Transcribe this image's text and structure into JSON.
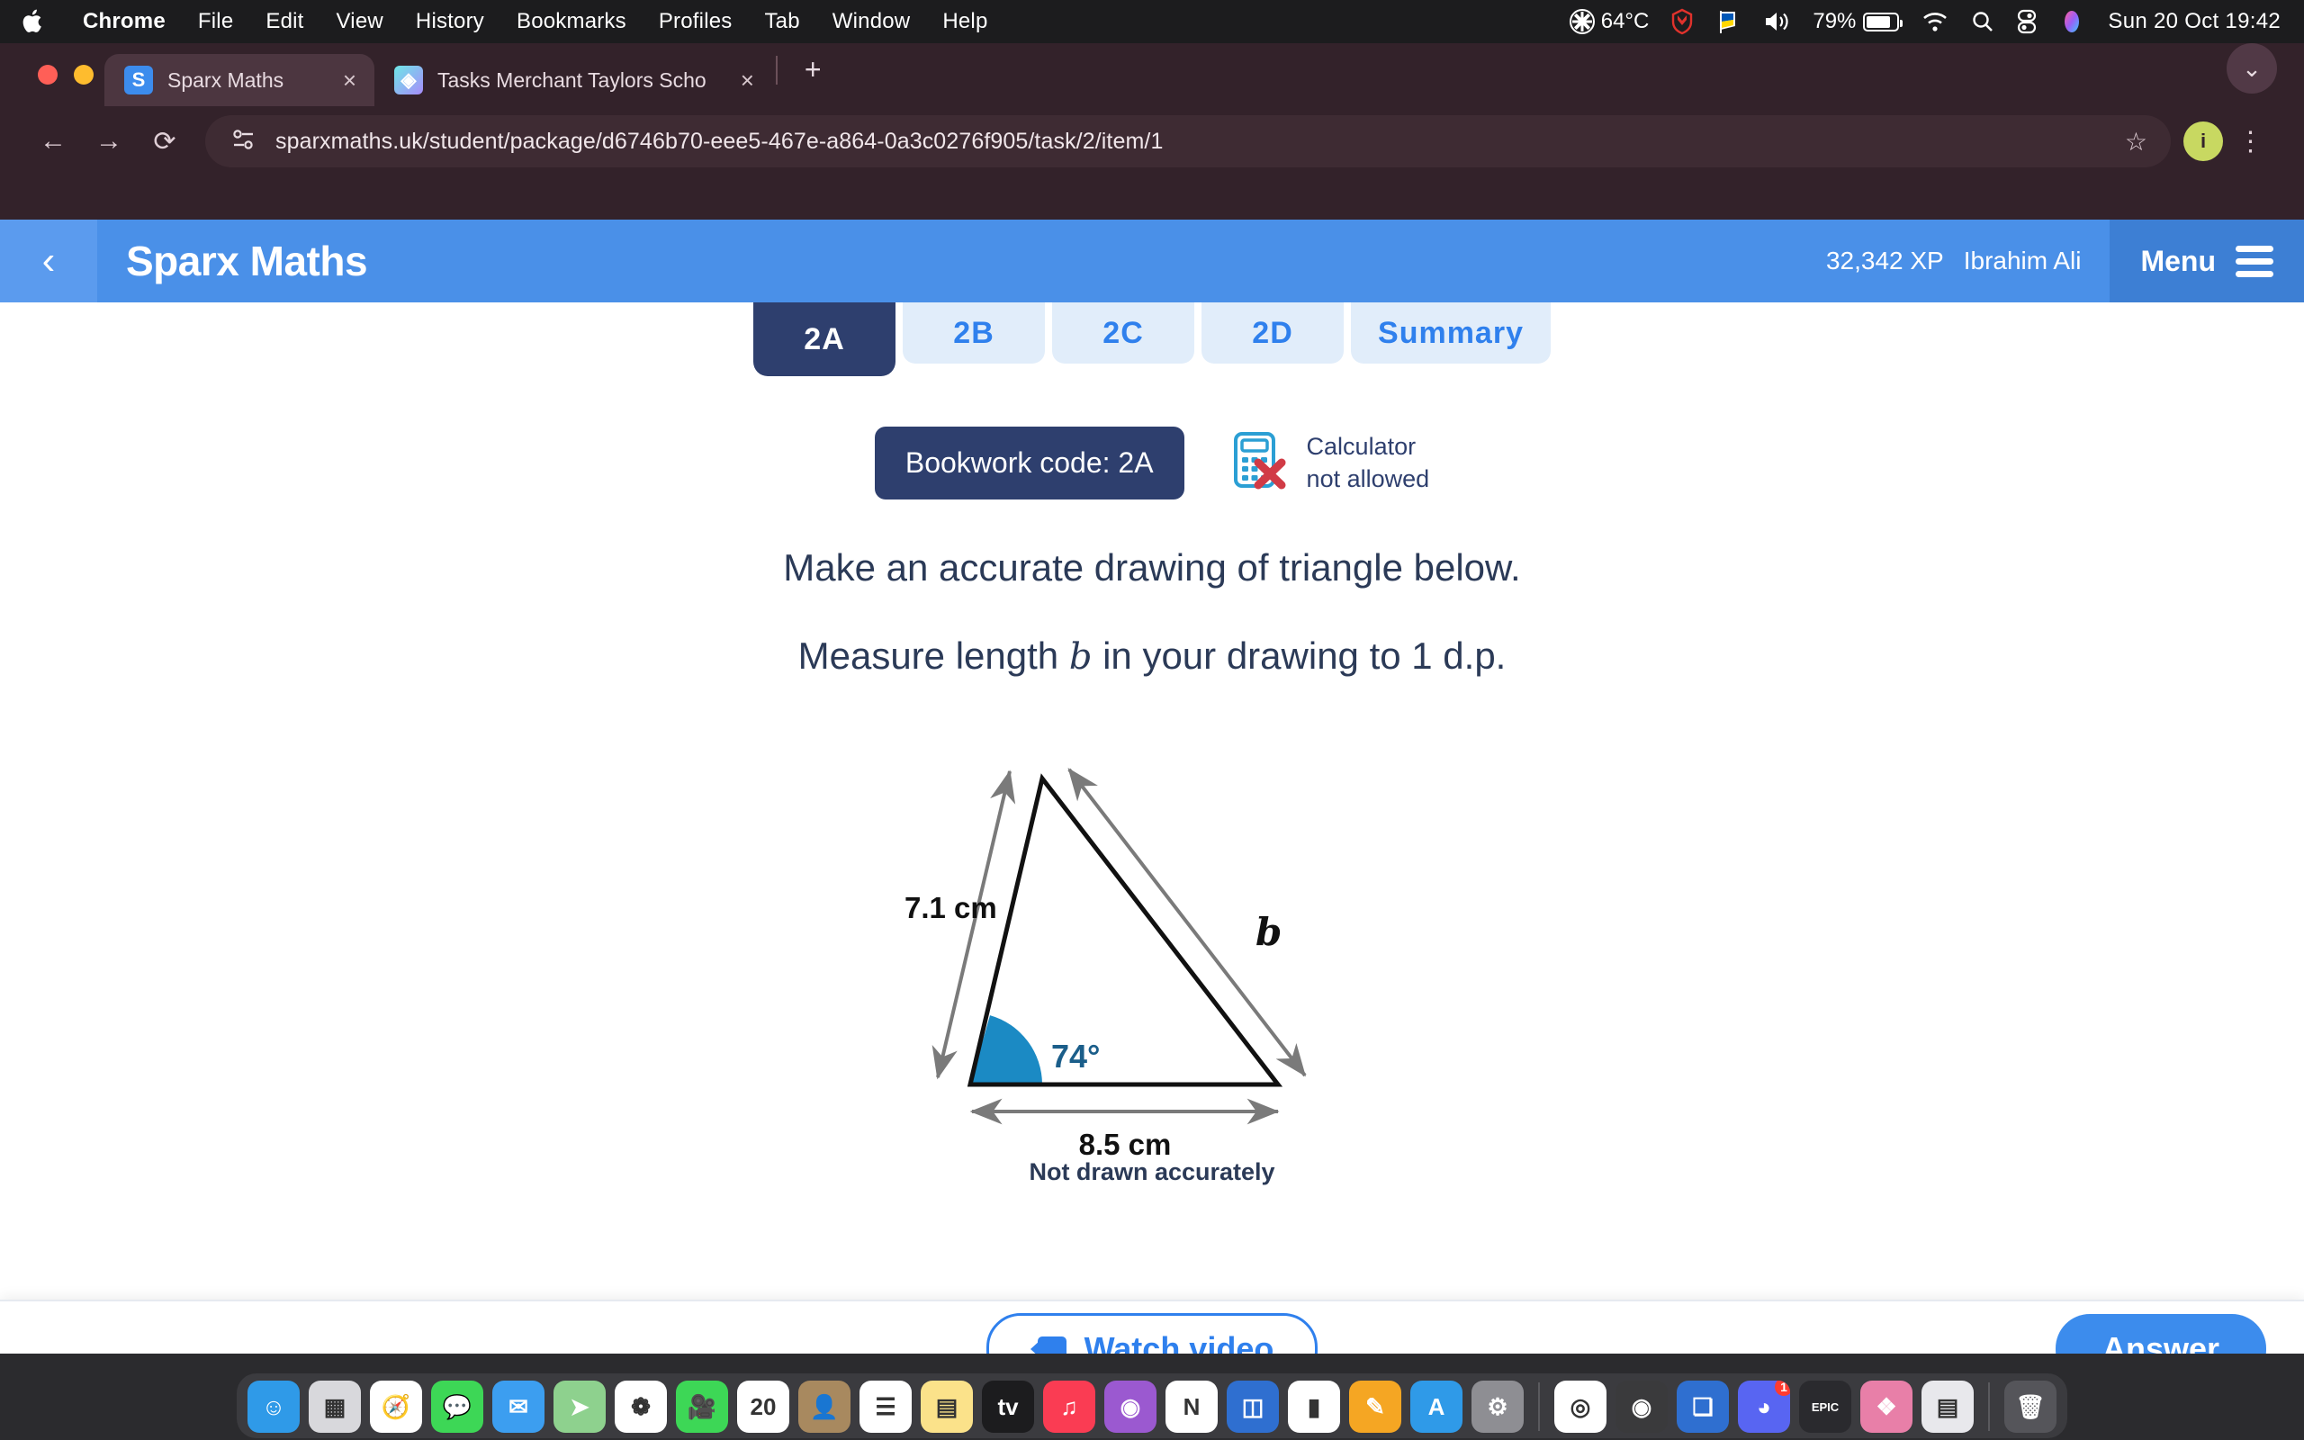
{
  "menubar": {
    "apple_icon": "apple-logo",
    "items": [
      "Chrome",
      "File",
      "Edit",
      "View",
      "History",
      "Bookmarks",
      "Profiles",
      "Tab",
      "Window",
      "Help"
    ],
    "status": {
      "temperature": "64°C",
      "battery_percent": "79%",
      "clock": "Sun 20 Oct  19:42",
      "icons": [
        "fan-icon",
        "shield-icon",
        "flag-icon",
        "volume-icon",
        "battery-icon",
        "wifi-icon",
        "search-icon",
        "control-center-icon",
        "siri-icon"
      ]
    }
  },
  "browser": {
    "tabs": [
      {
        "title": "Sparx Maths",
        "favicon": "sparx-favicon",
        "active": true,
        "close": "×"
      },
      {
        "title": "Tasks Merchant Taylors Scho",
        "favicon": "tasks-favicon",
        "active": false,
        "close": "×"
      }
    ],
    "new_tab_label": "+",
    "tabstrip_chevron": "⌄",
    "back_icon": "←",
    "forward_icon": "→",
    "reload_icon": "⟳",
    "site_info_icon": "page-settings-icon",
    "url": "sparxmaths.uk/student/package/d6746b70-eee5-467e-a864-0a3c0276f905/task/2/item/1",
    "bookmark_icon": "☆",
    "profile_initial": "i",
    "menu_icon": "⋮"
  },
  "app_header": {
    "back_icon": "‹",
    "title": "Sparx Maths",
    "xp": "32,342 XP",
    "user": "Ibrahim Ali",
    "menu_label": "Menu",
    "menu_icon": "hamburger-icon",
    "colors": {
      "header_bg": "#4a90e8",
      "menu_bg": "#3d7fd4"
    }
  },
  "question_tabs": [
    {
      "label": "2A",
      "active": true
    },
    {
      "label": "2B",
      "active": false
    },
    {
      "label": "2C",
      "active": false
    },
    {
      "label": "2D",
      "active": false
    },
    {
      "label": "Summary",
      "active": false
    }
  ],
  "meta": {
    "bookwork_code": "Bookwork code: 2A",
    "calculator_line1": "Calculator",
    "calculator_line2": "not allowed",
    "calculator_icon": "calculator-not-allowed-icon"
  },
  "question": {
    "line1": "Make an accurate drawing of triangle below.",
    "line2_before": "Measure length",
    "line2_var": "b",
    "line2_after": "in your drawing to 1 d.p.",
    "caption": "Not drawn accurately"
  },
  "figure": {
    "type": "triangle-diagram",
    "left_side_label": "7.1 cm",
    "base_label": "8.5 cm",
    "right_side_label": "b",
    "angle_label": "74°",
    "colors": {
      "angle_fill": "#1b8ac4",
      "angle_text": "#1b5e8a",
      "edge": "#111111",
      "dimension": "#7a7a7a"
    }
  },
  "bottom_bar": {
    "watch_video_label": "Watch video",
    "watch_video_icon": "video-camera-icon",
    "answer_label": "Answer",
    "colors": {
      "accent": "#3c8ced"
    }
  },
  "dock": {
    "items": [
      {
        "name": "finder",
        "glyph": "☺",
        "bg": "#2f9ae8",
        "running": true
      },
      {
        "name": "launchpad",
        "glyph": "▦",
        "bg": "#d8d8dc",
        "running": false
      },
      {
        "name": "safari",
        "glyph": "🧭",
        "bg": "#ffffff",
        "running": false
      },
      {
        "name": "messages",
        "glyph": "💬",
        "bg": "#3dd756",
        "running": false
      },
      {
        "name": "mail",
        "glyph": "✉",
        "bg": "#3c9ef0",
        "running": false
      },
      {
        "name": "maps",
        "glyph": "➤",
        "bg": "#8ed18e",
        "running": false
      },
      {
        "name": "photos",
        "glyph": "❁",
        "bg": "#ffffff",
        "running": false
      },
      {
        "name": "facetime",
        "glyph": "🎥",
        "bg": "#3dd756",
        "running": false
      },
      {
        "name": "calendar",
        "glyph": "20",
        "bg": "#ffffff",
        "running": false
      },
      {
        "name": "contacts",
        "glyph": "👤",
        "bg": "#a8895f",
        "running": false
      },
      {
        "name": "reminders",
        "glyph": "☰",
        "bg": "#ffffff",
        "running": false
      },
      {
        "name": "notes",
        "glyph": "▤",
        "bg": "#fbe28a",
        "running": false
      },
      {
        "name": "tv",
        "glyph": "tv",
        "bg": "#1c1c1e",
        "running": false
      },
      {
        "name": "music",
        "glyph": "♫",
        "bg": "#fa3c53",
        "running": false
      },
      {
        "name": "podcasts",
        "glyph": "◉",
        "bg": "#9b59d0",
        "running": false
      },
      {
        "name": "news",
        "glyph": "N",
        "bg": "#ffffff",
        "running": false
      },
      {
        "name": "keynote",
        "glyph": "◫",
        "bg": "#2f6fd0",
        "running": false
      },
      {
        "name": "numbers",
        "glyph": "▮",
        "bg": "#ffffff",
        "running": false
      },
      {
        "name": "pages",
        "glyph": "✎",
        "bg": "#f5a623",
        "running": false
      },
      {
        "name": "app-store",
        "glyph": "A",
        "bg": "#2f9ae8",
        "running": false
      },
      {
        "name": "settings",
        "glyph": "⚙",
        "bg": "#8e8e93",
        "running": false
      },
      {
        "name": "chrome",
        "glyph": "◎",
        "bg": "#ffffff",
        "running": true
      },
      {
        "name": "camera",
        "glyph": "◉",
        "bg": "#3a3a3c",
        "running": false
      },
      {
        "name": "windows-app",
        "glyph": "❏",
        "bg": "#2f6fd0",
        "running": false
      },
      {
        "name": "discord",
        "glyph": "◕",
        "bg": "#5865f2",
        "running": true,
        "badge": "1"
      },
      {
        "name": "epic-games",
        "glyph": "EPIC",
        "bg": "#2a2a2e",
        "running": false
      },
      {
        "name": "preview",
        "glyph": "❖",
        "bg": "#e87fa8",
        "running": false
      },
      {
        "name": "documents",
        "glyph": "▤",
        "bg": "#e8e8ec",
        "running": false
      },
      {
        "name": "trash",
        "glyph": "🗑",
        "bg": "#55555a",
        "running": false
      }
    ]
  }
}
